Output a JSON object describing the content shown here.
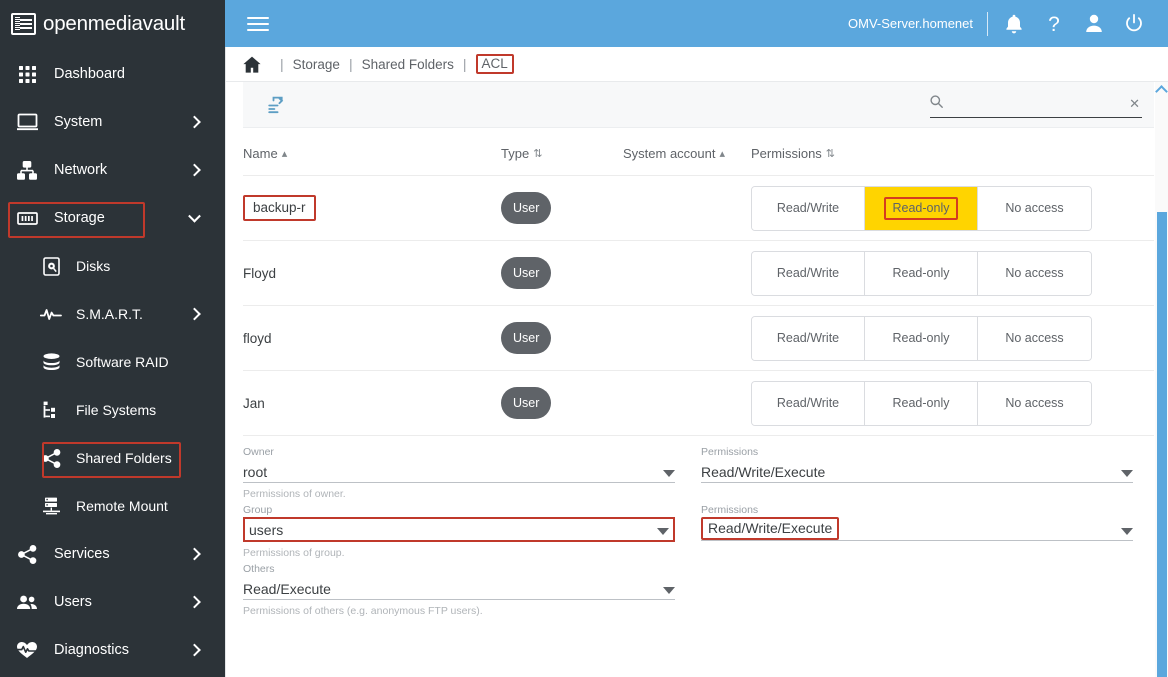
{
  "brand": {
    "name": "openmediavault",
    "logo_icon": "omv-logo-icon"
  },
  "sidebar": {
    "items": [
      {
        "label": "Dashboard",
        "icon": "grid-icon",
        "level": 0,
        "expandable": false,
        "highlighted": false
      },
      {
        "label": "System",
        "icon": "monitor-icon",
        "level": 0,
        "expandable": true,
        "expanded": false,
        "highlighted": false
      },
      {
        "label": "Network",
        "icon": "network-icon",
        "level": 0,
        "expandable": true,
        "expanded": false,
        "highlighted": false
      },
      {
        "label": "Storage",
        "icon": "storage-icon",
        "level": 0,
        "expandable": true,
        "expanded": true,
        "highlighted": true
      },
      {
        "label": "Disks",
        "icon": "disk-icon",
        "level": 1,
        "expandable": false,
        "highlighted": false
      },
      {
        "label": "S.M.A.R.T.",
        "icon": "pulse-icon",
        "level": 1,
        "expandable": true,
        "expanded": false,
        "highlighted": false
      },
      {
        "label": "Software RAID",
        "icon": "database-icon",
        "level": 1,
        "expandable": false,
        "highlighted": false
      },
      {
        "label": "File Systems",
        "icon": "filesystem-icon",
        "level": 1,
        "expandable": false,
        "highlighted": false
      },
      {
        "label": "Shared Folders",
        "icon": "share-icon",
        "level": 1,
        "expandable": false,
        "highlighted": true
      },
      {
        "label": "Remote Mount",
        "icon": "server-icon",
        "level": 1,
        "expandable": false,
        "highlighted": false
      },
      {
        "label": "Services",
        "icon": "share-icon",
        "level": 0,
        "expandable": true,
        "expanded": false,
        "highlighted": false
      },
      {
        "label": "Users",
        "icon": "users-icon",
        "level": 0,
        "expandable": true,
        "expanded": false,
        "highlighted": false
      },
      {
        "label": "Diagnostics",
        "icon": "heartbeat-icon",
        "level": 0,
        "expandable": true,
        "expanded": false,
        "highlighted": false
      }
    ]
  },
  "topbar": {
    "menu_icon": "hamburger-icon",
    "server_name": "OMV-Server.homenet",
    "icons": [
      {
        "name": "notifications-bell-icon"
      },
      {
        "name": "help-question-icon"
      },
      {
        "name": "user-account-icon"
      },
      {
        "name": "power-icon"
      }
    ],
    "background_color": "#5ba7dd"
  },
  "breadcrumb": {
    "home_icon": "home-icon",
    "separator": "|",
    "items": [
      {
        "label": "Storage",
        "current": false
      },
      {
        "label": "Shared Folders",
        "current": false
      },
      {
        "label": "ACL",
        "current": true
      }
    ]
  },
  "toolbar": {
    "apply_icon": "playlist-add-icon"
  },
  "search": {
    "icon": "search-icon",
    "value": "",
    "placeholder": "",
    "clear_icon": "close-icon"
  },
  "table": {
    "columns": [
      {
        "label": "Name",
        "sort": "asc"
      },
      {
        "label": "Type",
        "sort": "none"
      },
      {
        "label": "System account",
        "sort": "asc"
      },
      {
        "label": "Permissions",
        "sort": "none"
      }
    ],
    "permission_options": [
      "Read/Write",
      "Read-only",
      "No access"
    ],
    "rows": [
      {
        "name": "backup-r",
        "type": "User",
        "selected_permission": "Read-only",
        "name_highlighted": true,
        "permission_highlighted": true
      },
      {
        "name": "Floyd",
        "type": "User",
        "selected_permission": "",
        "name_highlighted": false,
        "permission_highlighted": false
      },
      {
        "name": "floyd",
        "type": "User",
        "selected_permission": "",
        "name_highlighted": false,
        "permission_highlighted": false
      },
      {
        "name": "Jan",
        "type": "User",
        "selected_permission": "",
        "name_highlighted": false,
        "permission_highlighted": false
      }
    ]
  },
  "form": {
    "fields": [
      {
        "label": "Owner",
        "value": "root",
        "hint": "Permissions of owner.",
        "highlighted": false
      },
      {
        "label": "Permissions",
        "value": "Read/Write/Execute",
        "hint": "",
        "highlighted": false
      },
      {
        "label": "Group",
        "value": "users",
        "hint": "Permissions of group.",
        "highlighted": true
      },
      {
        "label": "Permissions",
        "value": "Read/Write/Execute",
        "hint": "",
        "highlighted": true
      },
      {
        "label": "Others",
        "value": "Read/Execute",
        "hint": "Permissions of others (e.g. anonymous FTP users).",
        "highlighted": false
      }
    ]
  },
  "colors": {
    "accent": "#5ba7dd",
    "sidebar": "#2c3338",
    "highlight_box": "#c0392b",
    "selected_permission": "#ffd400",
    "chip": "#5f6368"
  }
}
